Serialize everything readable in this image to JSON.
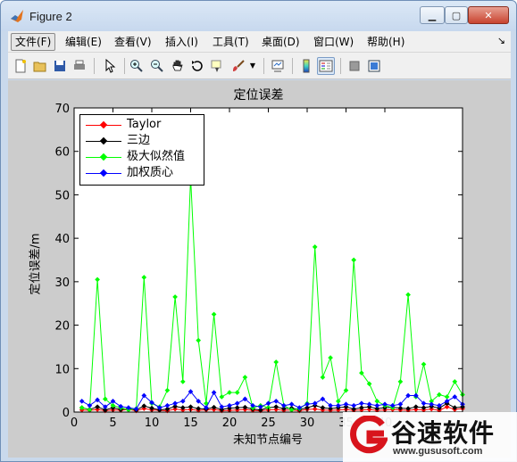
{
  "window": {
    "title": "Figure 2",
    "min_symbol": "▁",
    "max_symbol": "▢",
    "close_symbol": "✕"
  },
  "menu": {
    "items": [
      {
        "label": "文件(F)"
      },
      {
        "label": "编辑(E)"
      },
      {
        "label": "查看(V)"
      },
      {
        "label": "插入(I)"
      },
      {
        "label": "工具(T)"
      },
      {
        "label": "桌面(D)"
      },
      {
        "label": "窗口(W)"
      },
      {
        "label": "帮助(H)"
      }
    ],
    "chevron": "↘"
  },
  "toolbar": {
    "icons": [
      "new-figure-icon",
      "open-file-icon",
      "save-icon",
      "print-icon",
      "pointer-icon",
      "zoom-in-icon",
      "zoom-out-icon",
      "pan-hand-icon",
      "rotate-3d-icon",
      "data-cursor-icon",
      "brush-icon",
      "brush-dropdown-icon",
      "link-plot-icon",
      "colorbar-icon",
      "legend-icon",
      "hide-plot-tools-icon",
      "show-plot-tools-icon"
    ]
  },
  "watermark": {
    "name": "谷速软件",
    "url": "www.gususoft.com"
  },
  "chart_data": {
    "type": "line",
    "title": "定位误差",
    "xlabel": "未知节点编号",
    "ylabel": "定位误差/m",
    "xlim": [
      0,
      50
    ],
    "ylim": [
      0,
      70
    ],
    "xticks": [
      0,
      5,
      10,
      15,
      20,
      25,
      30,
      35,
      40
    ],
    "yticks": [
      0,
      10,
      20,
      30,
      40,
      50,
      60,
      70
    ],
    "legend_position": "top-left",
    "grid": false,
    "x": [
      1,
      2,
      3,
      4,
      5,
      6,
      7,
      8,
      9,
      10,
      11,
      12,
      13,
      14,
      15,
      16,
      17,
      18,
      19,
      20,
      21,
      22,
      23,
      24,
      25,
      26,
      27,
      28,
      29,
      30,
      31,
      32,
      33,
      34,
      35,
      36,
      37,
      38,
      39,
      40,
      41,
      42,
      43,
      44,
      45,
      46,
      47,
      48,
      49,
      50
    ],
    "series": [
      {
        "name": "Taylor",
        "color": "#ff0000",
        "values": [
          0.5,
          0.4,
          0.6,
          0.3,
          0.5,
          0.4,
          0.6,
          0.3,
          0.8,
          0.5,
          0.4,
          0.3,
          0.7,
          0.5,
          0.6,
          0.4,
          0.5,
          0.6,
          0.3,
          0.4,
          0.5,
          0.6,
          0.4,
          0.3,
          0.5,
          0.6,
          0.4,
          0.5,
          0.3,
          0.6,
          0.7,
          0.5,
          0.4,
          0.5,
          0.6,
          0.4,
          0.5,
          0.6,
          0.4,
          0.5,
          0.6,
          0.5,
          0.4,
          0.6,
          0.5,
          0.7,
          0.4,
          1.2,
          0.6,
          0.8
        ]
      },
      {
        "name": "三边",
        "color": "#000000",
        "values": [
          1.0,
          0.6,
          1.2,
          0.5,
          1.0,
          0.6,
          0.8,
          0.5,
          1.4,
          0.9,
          0.5,
          0.7,
          1.3,
          1.0,
          1.2,
          0.8,
          0.7,
          1.1,
          0.6,
          0.9,
          1.0,
          1.1,
          0.7,
          0.5,
          1.0,
          1.2,
          0.8,
          0.9,
          0.6,
          1.0,
          1.5,
          1.0,
          0.8,
          1.0,
          1.2,
          0.7,
          1.0,
          1.2,
          0.8,
          1.0,
          1.1,
          0.9,
          0.8,
          1.2,
          1.0,
          1.3,
          0.9,
          2.0,
          1.0,
          1.2
        ]
      },
      {
        "name": "极大似然值",
        "color": "#00ff00",
        "values": [
          1.0,
          0.5,
          30.5,
          3.0,
          1.5,
          1.0,
          0.5,
          0.8,
          31.0,
          2.0,
          1.2,
          5.0,
          26.5,
          7.0,
          54.0,
          16.5,
          2.0,
          22.5,
          3.5,
          4.5,
          4.5,
          8.0,
          1.0,
          1.5,
          1.0,
          11.5,
          1.5,
          0.5,
          0.8,
          2.0,
          38.0,
          8.0,
          12.5,
          2.5,
          5.0,
          35.0,
          9.0,
          6.5,
          2.5,
          1.5,
          1.0,
          7.0,
          27.0,
          3.5,
          11.0,
          2.5,
          4.0,
          3.5,
          7.0,
          4.0
        ]
      },
      {
        "name": "加权质心",
        "color": "#0000ff",
        "values": [
          2.5,
          1.5,
          2.8,
          1.2,
          2.5,
          1.3,
          1.0,
          0.7,
          3.8,
          2.2,
          1.0,
          1.5,
          2.0,
          2.5,
          4.7,
          2.5,
          1.0,
          4.5,
          1.2,
          1.5,
          2.0,
          3.0,
          1.5,
          1.2,
          2.0,
          2.5,
          1.5,
          1.8,
          1.0,
          1.8,
          2.0,
          3.0,
          1.5,
          1.5,
          1.8,
          1.5,
          2.0,
          1.8,
          1.5,
          1.8,
          1.5,
          1.8,
          3.8,
          3.8,
          2.0,
          1.8,
          1.5,
          2.5,
          3.5,
          1.8
        ]
      }
    ]
  }
}
